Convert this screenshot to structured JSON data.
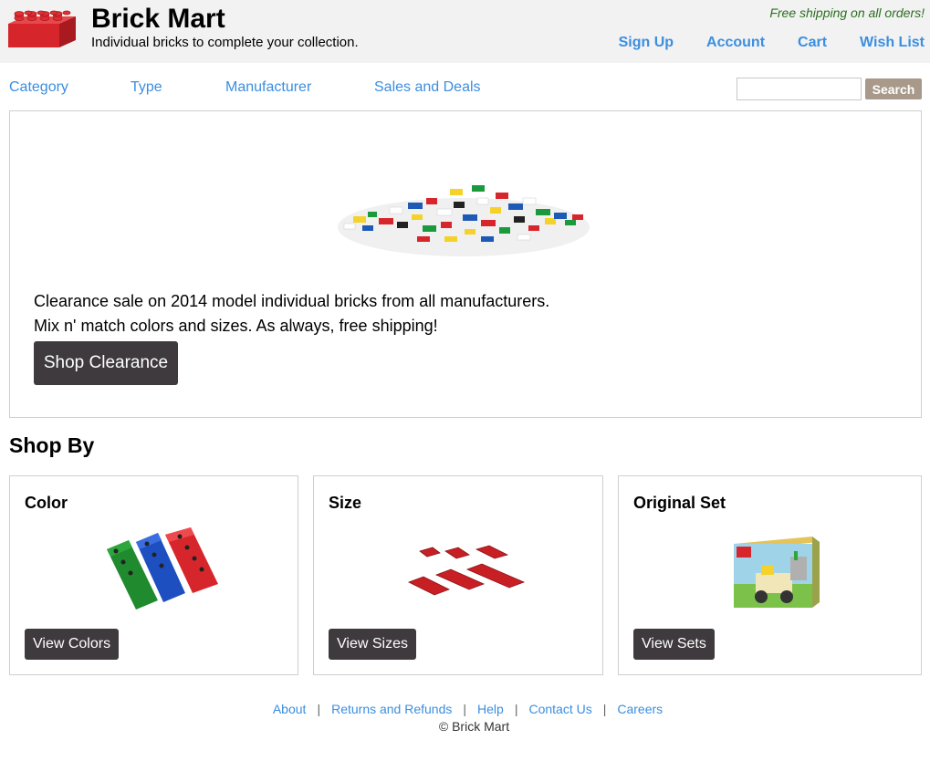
{
  "header": {
    "title": "Brick Mart",
    "tagline": "Individual bricks to complete your collection.",
    "promo": "Free shipping on all orders!",
    "account_links": [
      "Sign Up",
      "Account",
      "Cart",
      "Wish List"
    ]
  },
  "category_nav": [
    "Category",
    "Type",
    "Manufacturer",
    "Sales and Deals"
  ],
  "search": {
    "value": "",
    "placeholder": "",
    "button_label": "Search"
  },
  "hero": {
    "line1": "Clearance sale on 2014 model individual bricks from all manufacturers.",
    "line2": "Mix n' match colors and sizes. As always, free shipping!",
    "button_label": "Shop Clearance"
  },
  "shop_by": {
    "heading": "Shop By",
    "cards": [
      {
        "title": "Color",
        "button_label": "View Colors"
      },
      {
        "title": "Size",
        "button_label": "View Sizes"
      },
      {
        "title": "Original Set",
        "button_label": "View Sets"
      }
    ]
  },
  "footer": {
    "links": [
      "About",
      "Returns and Refunds",
      "Help",
      "Contact Us",
      "Careers"
    ],
    "copyright": "© Brick Mart"
  },
  "colors": {
    "link": "#3b8ee0",
    "header_bg": "#f2f2f2",
    "promo": "#2a6f1f",
    "dark_button": "#3f3a3d",
    "search_button": "#a8998b",
    "brick_red": "#d6262b"
  }
}
